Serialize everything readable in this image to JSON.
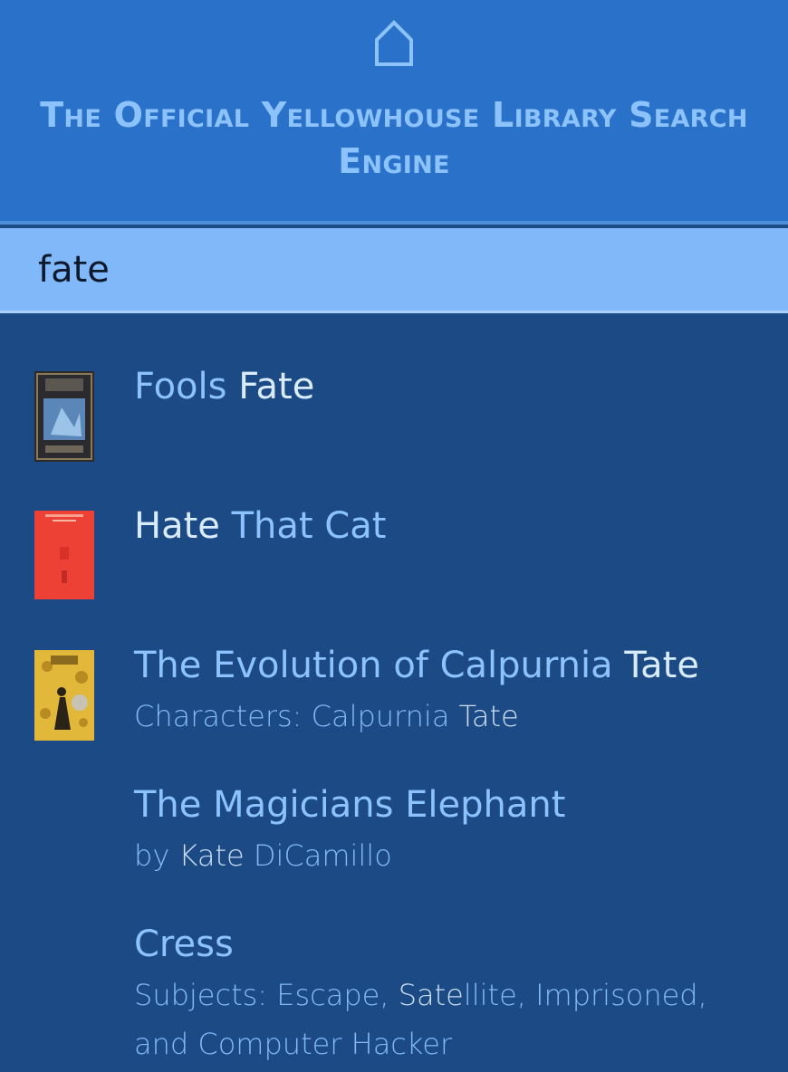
{
  "header": {
    "home_icon": "house-outline-icon",
    "title": "The Official Yellowhouse Library Search Engine"
  },
  "search": {
    "value": "fate",
    "placeholder": ""
  },
  "results": [
    {
      "title_parts": [
        "Fools ",
        "Fate"
      ],
      "subtitle": "",
      "cover": "Fools Fate cover (dark blue)"
    },
    {
      "title_parts": [
        "Hate",
        " That Cat"
      ],
      "subtitle": "",
      "cover": "Hate That Cat cover (red)"
    },
    {
      "title_parts": [
        "The Evolution of Calpurnia ",
        "Tate"
      ],
      "subtitle_parts": [
        "Characters: Calpurnia ",
        "Tate"
      ],
      "cover": "The Evolution of Calpurnia Tate cover (yellow)"
    },
    {
      "title_parts": [
        "The Magicians Elephant",
        ""
      ],
      "subtitle_parts": [
        "by ",
        "Kate",
        " DiCamillo"
      ]
    },
    {
      "title_parts": [
        "Cress",
        ""
      ],
      "subtitle_parts": [
        "Subjects: Escape, ",
        "Sate",
        "llite, Imprisoned, and Computer Hacker"
      ]
    }
  ],
  "colors": {
    "header_bg": "#2a72c9",
    "search_bg": "#80b8fa",
    "results_bg": "#1c4a85",
    "link": "#8cc3ff",
    "highlight": "#d9ebff"
  }
}
